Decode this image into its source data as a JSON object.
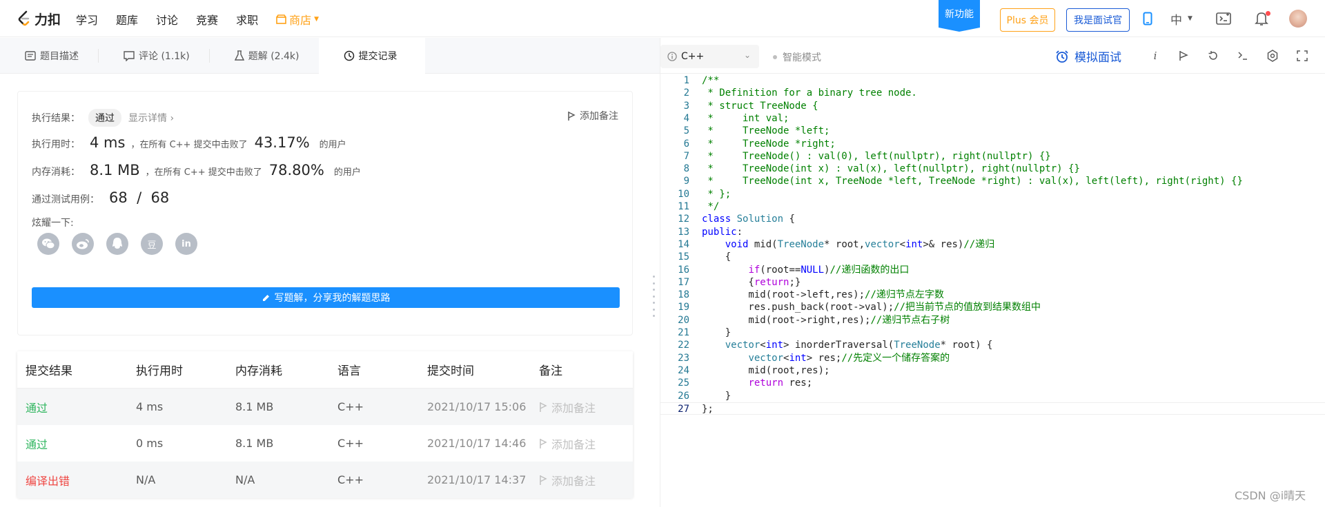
{
  "topnav": {
    "logo_text": "力扣",
    "links": [
      "学习",
      "题库",
      "讨论",
      "竞赛",
      "求职"
    ],
    "shop_label": "商店",
    "new_feature": "新功能",
    "plus_label": "Plus 会员",
    "interviewer_label": "我是面试官",
    "lang_label": "中"
  },
  "left_tabs": [
    {
      "label": "题目描述",
      "icon": "document-icon"
    },
    {
      "label": "评论 (1.1k)",
      "icon": "comment-icon"
    },
    {
      "label": "题解 (2.4k)",
      "icon": "flask-icon"
    },
    {
      "label": "提交记录",
      "icon": "clock-icon"
    }
  ],
  "result": {
    "exec_result_label": "执行结果：",
    "status": "通过",
    "show_details": "显示详情 ›",
    "add_note": "添加备注",
    "time_label": "执行用时：",
    "time_value": "4 ms",
    "time_mid": "，在所有 C++ 提交中击败了",
    "time_pct": "43.17%",
    "time_suffix": "的用户",
    "mem_label": "内存消耗：",
    "mem_value": "8.1 MB",
    "mem_mid": "，在所有 C++ 提交中击败了",
    "mem_pct": "78.80%",
    "mem_suffix": "的用户",
    "cases_label": "通过测试用例：",
    "cases_value": "68  /  68",
    "share_label": "炫耀一下:",
    "share_icons": [
      "wechat-icon",
      "weibo-icon",
      "qq-icon",
      "douban-icon",
      "linkedin-icon"
    ],
    "douban_glyph": "豆",
    "linkedin_glyph": "in",
    "write_solution": "写题解，分享我的解题思路"
  },
  "submissions": {
    "headers": [
      "提交结果",
      "执行用时",
      "内存消耗",
      "语言",
      "提交时间",
      "备注"
    ],
    "rows": [
      {
        "result": "通过",
        "time": "4 ms",
        "memory": "8.1 MB",
        "lang": "C++",
        "submitted": "2021/10/17 15:06",
        "note": "添加备注",
        "status": "ok"
      },
      {
        "result": "通过",
        "time": "0 ms",
        "memory": "8.1 MB",
        "lang": "C++",
        "submitted": "2021/10/17 14:46",
        "note": "添加备注",
        "status": "ok"
      },
      {
        "result": "编译出错",
        "time": "N/A",
        "memory": "N/A",
        "lang": "C++",
        "submitted": "2021/10/17 14:37",
        "note": "添加备注",
        "status": "err"
      }
    ]
  },
  "editor_toolbar": {
    "language": "C++",
    "smart_mode": "智能模式",
    "mock_interview": "模拟面试"
  },
  "code_lines": [
    "/**",
    " * Definition for a binary tree node.",
    " * struct TreeNode {",
    " *     int val;",
    " *     TreeNode *left;",
    " *     TreeNode *right;",
    " *     TreeNode() : val(0), left(nullptr), right(nullptr) {}",
    " *     TreeNode(int x) : val(x), left(nullptr), right(nullptr) {}",
    " *     TreeNode(int x, TreeNode *left, TreeNode *right) : val(x), left(left), right(right) {}",
    " * };",
    " */",
    "class Solution {",
    "public:",
    "    void mid(TreeNode* root,vector<int>& res)//递归",
    "    {",
    "        if(root==NULL)//递归函数的出口",
    "        {return;}",
    "        mid(root->left,res);//递归节点左字数",
    "        res.push_back(root->val);//把当前节点的值放到结果数组中",
    "        mid(root->right,res);//递归节点右子树",
    "    }",
    "    vector<int> inorderTraversal(TreeNode* root) {",
    "        vector<int> res;//先定义一个储存答案的",
    "        mid(root,res);",
    "        return res;",
    "    }",
    "};"
  ],
  "watermark": "CSDN @i晴天"
}
